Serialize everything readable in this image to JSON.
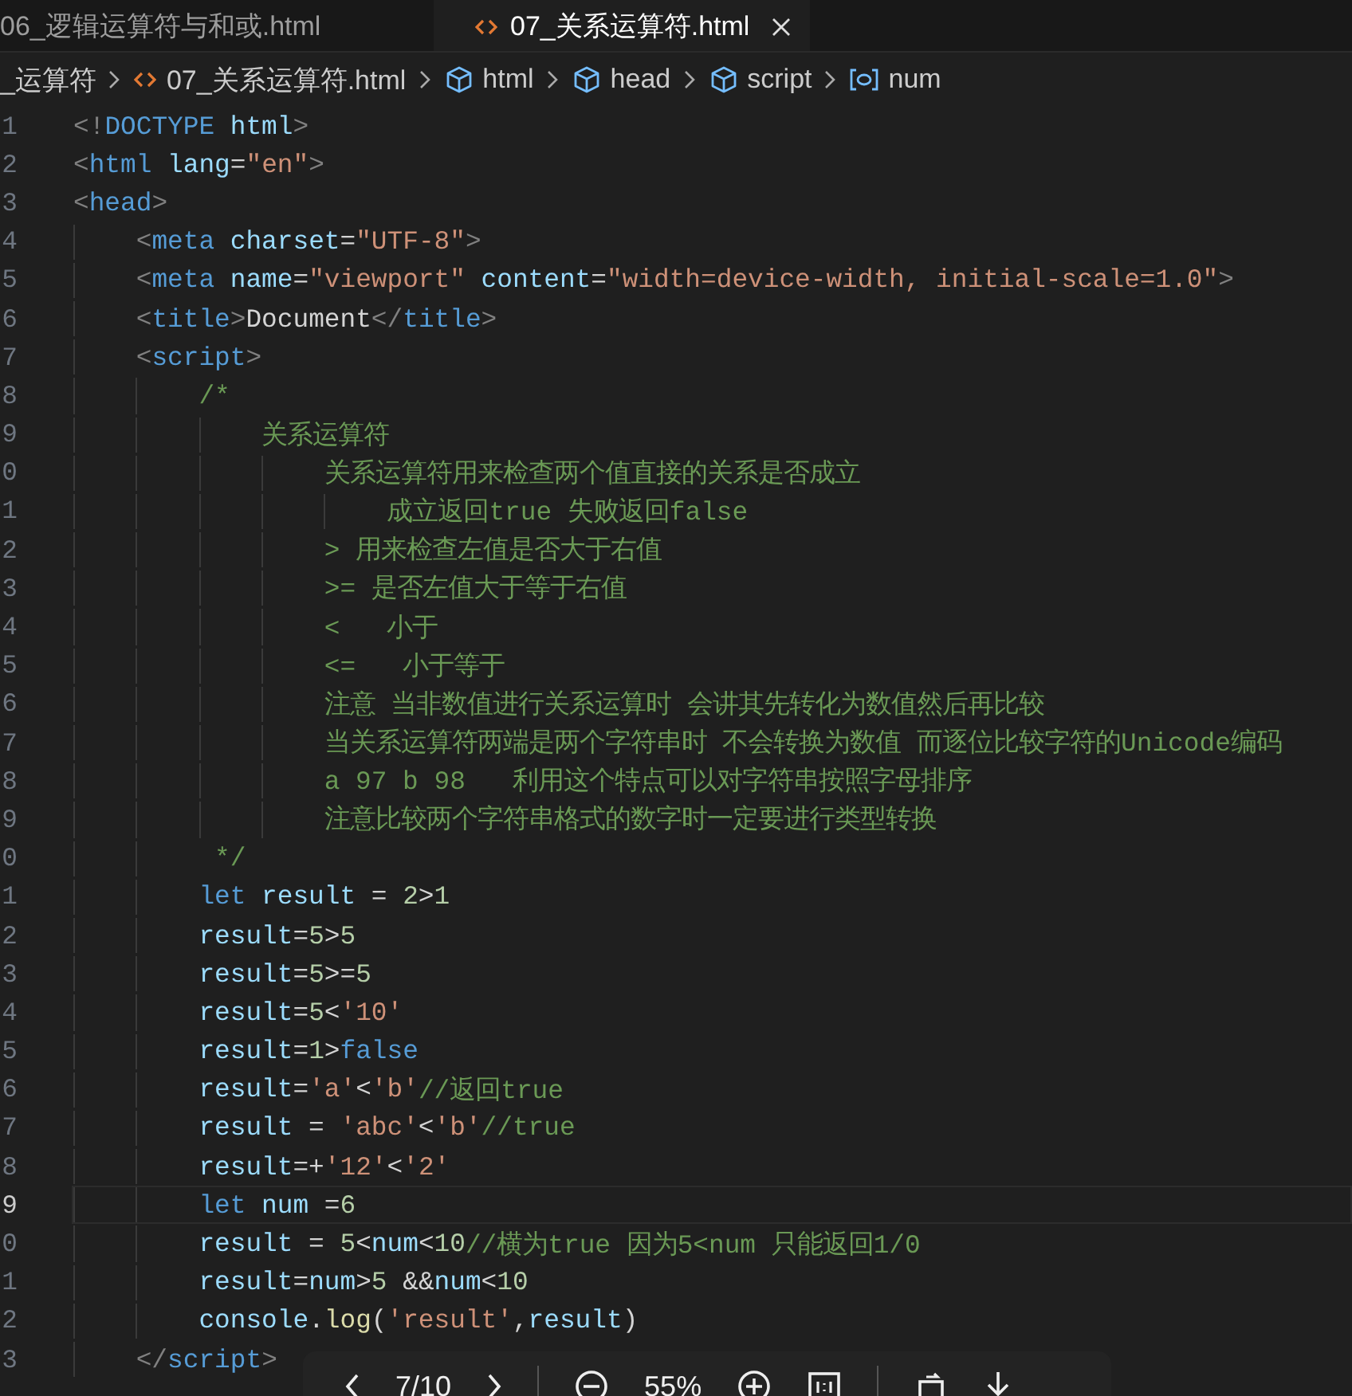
{
  "tabs": [
    {
      "label": "06_逻辑运算符与和或.html",
      "selected": false
    },
    {
      "label": "07_关系运算符.html",
      "selected": true
    }
  ],
  "breadcrumbs": [
    {
      "label": "_运算符",
      "kind": "folder"
    },
    {
      "label": "07_关系运算符.html",
      "kind": "file"
    },
    {
      "label": "html",
      "kind": "element"
    },
    {
      "label": "head",
      "kind": "element"
    },
    {
      "label": "script",
      "kind": "element"
    },
    {
      "label": "num",
      "kind": "variable"
    }
  ],
  "lines": [
    {
      "number": "1",
      "current": false,
      "tokens": [
        {
          "t": "<!",
          "kind": "punct"
        },
        {
          "t": "DOCTYPE",
          "kind": "tag"
        },
        {
          "t": " html",
          "kind": "attr"
        },
        {
          "t": ">",
          "kind": "punct"
        }
      ]
    },
    {
      "number": "2",
      "current": false,
      "tokens": [
        {
          "t": "<",
          "kind": "punct"
        },
        {
          "t": "html",
          "kind": "tag"
        },
        {
          "t": " lang",
          "kind": "attr"
        },
        {
          "t": "=",
          "kind": "text"
        },
        {
          "t": "\"en\"",
          "kind": "str"
        },
        {
          "t": ">",
          "kind": "punct"
        }
      ]
    },
    {
      "number": "3",
      "current": false,
      "tokens": [
        {
          "t": "<",
          "kind": "punct"
        },
        {
          "t": "head",
          "kind": "tag"
        },
        {
          "t": ">",
          "kind": "punct"
        }
      ],
      "children": [
        {
          "number": "4",
          "current": false,
          "tokens": [
            {
              "t": "<",
              "kind": "punct"
            },
            {
              "t": "meta",
              "kind": "tag"
            },
            {
              "t": " charset",
              "kind": "attr"
            },
            {
              "t": "=",
              "kind": "text"
            },
            {
              "t": "\"UTF-8\"",
              "kind": "str"
            },
            {
              "t": ">",
              "kind": "punct"
            }
          ]
        },
        {
          "number": "5",
          "current": false,
          "tokens": [
            {
              "t": "<",
              "kind": "punct"
            },
            {
              "t": "meta",
              "kind": "tag"
            },
            {
              "t": " name",
              "kind": "attr"
            },
            {
              "t": "=",
              "kind": "text"
            },
            {
              "t": "\"viewport\"",
              "kind": "str"
            },
            {
              "t": " content",
              "kind": "attr"
            },
            {
              "t": "=",
              "kind": "text"
            },
            {
              "t": "\"width=device-width, initial-scale=1.0\"",
              "kind": "str"
            },
            {
              "t": ">",
              "kind": "punct"
            }
          ]
        },
        {
          "number": "6",
          "current": false,
          "tokens": [
            {
              "t": "<",
              "kind": "punct"
            },
            {
              "t": "title",
              "kind": "tag"
            },
            {
              "t": ">",
              "kind": "punct"
            },
            {
              "t": "Document",
              "kind": "text"
            },
            {
              "t": "</",
              "kind": "punct"
            },
            {
              "t": "title",
              "kind": "tag"
            },
            {
              "t": ">",
              "kind": "punct"
            }
          ]
        },
        {
          "number": "7",
          "current": false,
          "tokens": [
            {
              "t": "<",
              "kind": "punct"
            },
            {
              "t": "script",
              "kind": "tag"
            },
            {
              "t": ">",
              "kind": "punct"
            }
          ],
          "children": [
            {
              "number": "8",
              "current": false,
              "tokens": [
                {
                  "t": "/*",
                  "kind": "comment"
                }
              ],
              "children": [
                {
                  "number": "9",
                  "current": false,
                  "tokens": [
                    {
                      "t": "关系运算符",
                      "kind": "comment"
                    }
                  ],
                  "children": [
                    {
                      "number": "0",
                      "current": false,
                      "tokens": [
                        {
                          "t": "关系运算符用来检查两个值直接的关系是否成立",
                          "kind": "comment"
                        }
                      ],
                      "children": [
                        {
                          "number": "1",
                          "current": false,
                          "tokens": [
                            {
                              "t": "成立返回true 失败返回false",
                              "kind": "comment"
                            }
                          ]
                        }
                      ]
                    },
                    {
                      "number": "2",
                      "current": false,
                      "tokens": [
                        {
                          "t": "> 用来检查左值是否大于右值",
                          "kind": "comment"
                        }
                      ]
                    },
                    {
                      "number": "3",
                      "current": false,
                      "tokens": [
                        {
                          "t": ">= 是否左值大于等于右值",
                          "kind": "comment"
                        }
                      ]
                    },
                    {
                      "number": "4",
                      "current": false,
                      "tokens": [
                        {
                          "t": "<   小于",
                          "kind": "comment"
                        }
                      ]
                    },
                    {
                      "number": "5",
                      "current": false,
                      "tokens": [
                        {
                          "t": "<=   小于等于",
                          "kind": "comment"
                        }
                      ]
                    },
                    {
                      "number": "6",
                      "current": false,
                      "tokens": [
                        {
                          "t": "注意 当非数值进行关系运算时 会讲其先转化为数值然后再比较",
                          "kind": "comment"
                        }
                      ]
                    },
                    {
                      "number": "7",
                      "current": false,
                      "tokens": [
                        {
                          "t": "当关系运算符两端是两个字符串时 不会转换为数值 而逐位比较字符的Unicode编码",
                          "kind": "comment"
                        }
                      ]
                    },
                    {
                      "number": "8",
                      "current": false,
                      "tokens": [
                        {
                          "t": "a 97 b 98   利用这个特点可以对字符串按照字母排序",
                          "kind": "comment"
                        }
                      ]
                    },
                    {
                      "number": "9",
                      "current": false,
                      "tokens": [
                        {
                          "t": "注意比较两个字符串格式的数字时一定要进行类型转换",
                          "kind": "comment"
                        }
                      ]
                    }
                  ]
                }
              ]
            },
            {
              "number": "0",
              "current": false,
              "tokens": [
                {
                  "t": " */",
                  "kind": "comment"
                }
              ]
            },
            {
              "number": "1",
              "current": false,
              "tokens": [
                {
                  "t": "let",
                  "kind": "kw"
                },
                {
                  "t": " result",
                  "kind": "var"
                },
                {
                  "t": " = ",
                  "kind": "text"
                },
                {
                  "t": "2",
                  "kind": "num"
                },
                {
                  "t": ">",
                  "kind": "text"
                },
                {
                  "t": "1",
                  "kind": "num"
                }
              ]
            },
            {
              "number": "2",
              "current": false,
              "tokens": [
                {
                  "t": "result",
                  "kind": "var"
                },
                {
                  "t": "=",
                  "kind": "text"
                },
                {
                  "t": "5",
                  "kind": "num"
                },
                {
                  "t": ">",
                  "kind": "text"
                },
                {
                  "t": "5",
                  "kind": "num"
                }
              ]
            },
            {
              "number": "3",
              "current": false,
              "tokens": [
                {
                  "t": "result",
                  "kind": "var"
                },
                {
                  "t": "=",
                  "kind": "text"
                },
                {
                  "t": "5",
                  "kind": "num"
                },
                {
                  "t": ">=",
                  "kind": "text"
                },
                {
                  "t": "5",
                  "kind": "num"
                }
              ]
            },
            {
              "number": "4",
              "current": false,
              "tokens": [
                {
                  "t": "result",
                  "kind": "var"
                },
                {
                  "t": "=",
                  "kind": "text"
                },
                {
                  "t": "5",
                  "kind": "num"
                },
                {
                  "t": "<",
                  "kind": "text"
                },
                {
                  "t": "'10'",
                  "kind": "str"
                }
              ]
            },
            {
              "number": "5",
              "current": false,
              "tokens": [
                {
                  "t": "result",
                  "kind": "var"
                },
                {
                  "t": "=",
                  "kind": "text"
                },
                {
                  "t": "1",
                  "kind": "num"
                },
                {
                  "t": ">",
                  "kind": "text"
                },
                {
                  "t": "false",
                  "kind": "kw"
                }
              ]
            },
            {
              "number": "6",
              "current": false,
              "tokens": [
                {
                  "t": "result",
                  "kind": "var"
                },
                {
                  "t": "=",
                  "kind": "text"
                },
                {
                  "t": "'a'",
                  "kind": "str"
                },
                {
                  "t": "<",
                  "kind": "text"
                },
                {
                  "t": "'b'",
                  "kind": "str"
                },
                {
                  "t": "//返回true",
                  "kind": "comment"
                }
              ]
            },
            {
              "number": "7",
              "current": false,
              "tokens": [
                {
                  "t": "result",
                  "kind": "var"
                },
                {
                  "t": " = ",
                  "kind": "text"
                },
                {
                  "t": "'abc'",
                  "kind": "str"
                },
                {
                  "t": "<",
                  "kind": "text"
                },
                {
                  "t": "'b'",
                  "kind": "str"
                },
                {
                  "t": "//true",
                  "kind": "comment"
                }
              ]
            },
            {
              "number": "8",
              "current": false,
              "tokens": [
                {
                  "t": "result",
                  "kind": "var"
                },
                {
                  "t": "=+",
                  "kind": "text"
                },
                {
                  "t": "'12'",
                  "kind": "str"
                },
                {
                  "t": "<",
                  "kind": "text"
                },
                {
                  "t": "'2'",
                  "kind": "str"
                }
              ]
            },
            {
              "number": "9",
              "current": true,
              "tokens": [
                {
                  "t": "let",
                  "kind": "kw"
                },
                {
                  "t": " num",
                  "kind": "var"
                },
                {
                  "t": " =",
                  "kind": "text"
                },
                {
                  "t": "6",
                  "kind": "num"
                }
              ]
            },
            {
              "number": "0",
              "current": false,
              "tokens": [
                {
                  "t": "result",
                  "kind": "var"
                },
                {
                  "t": " = ",
                  "kind": "text"
                },
                {
                  "t": "5",
                  "kind": "num"
                },
                {
                  "t": "<",
                  "kind": "text"
                },
                {
                  "t": "num",
                  "kind": "var"
                },
                {
                  "t": "<",
                  "kind": "text"
                },
                {
                  "t": "10",
                  "kind": "num"
                },
                {
                  "t": "//横为true 因为5<num 只能返回1/0",
                  "kind": "comment"
                }
              ]
            },
            {
              "number": "1",
              "current": false,
              "tokens": [
                {
                  "t": "result",
                  "kind": "var"
                },
                {
                  "t": "=",
                  "kind": "text"
                },
                {
                  "t": "num",
                  "kind": "var"
                },
                {
                  "t": ">",
                  "kind": "text"
                },
                {
                  "t": "5",
                  "kind": "num"
                },
                {
                  "t": " &&",
                  "kind": "text"
                },
                {
                  "t": "num",
                  "kind": "var"
                },
                {
                  "t": "<",
                  "kind": "text"
                },
                {
                  "t": "10",
                  "kind": "num"
                }
              ]
            },
            {
              "number": "2",
              "current": false,
              "tokens": [
                {
                  "t": "console",
                  "kind": "var"
                },
                {
                  "t": ".",
                  "kind": "text"
                },
                {
                  "t": "log",
                  "kind": "fn"
                },
                {
                  "t": "(",
                  "kind": "text"
                },
                {
                  "t": "'result'",
                  "kind": "str"
                },
                {
                  "t": ",",
                  "kind": "text"
                },
                {
                  "t": "result",
                  "kind": "var"
                },
                {
                  "t": ")",
                  "kind": "text"
                }
              ]
            }
          ]
        },
        {
          "number": "3",
          "current": false,
          "tokens": [
            {
              "t": "</",
              "kind": "punct"
            },
            {
              "t": "script",
              "kind": "tag"
            },
            {
              "t": ">",
              "kind": "punct"
            }
          ]
        }
      ]
    }
  ],
  "viewer": {
    "page": "7/10",
    "zoom": "55%"
  }
}
